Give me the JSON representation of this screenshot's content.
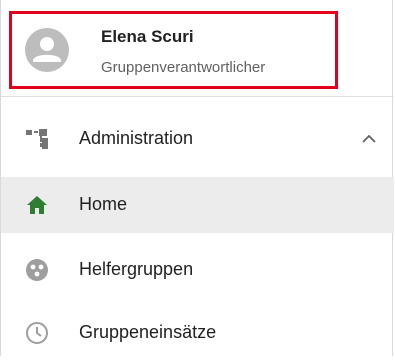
{
  "profile": {
    "name": "Elena Scuri",
    "role": "Gruppenverantwortlicher"
  },
  "menu": {
    "items": [
      {
        "label": "Administration",
        "icon": "hierarchy-icon",
        "expanded": true
      },
      {
        "label": "Home",
        "icon": "home-icon",
        "active": true
      },
      {
        "label": "Helfergruppen",
        "icon": "group-dots-icon"
      },
      {
        "label": "Gruppeneinsätze",
        "icon": "clock-icon"
      }
    ]
  },
  "colors": {
    "highlight_border": "#e3001b",
    "active_background": "#ececec",
    "home_icon": "#2e7d32",
    "icon_gray": "#9e9e9e"
  }
}
